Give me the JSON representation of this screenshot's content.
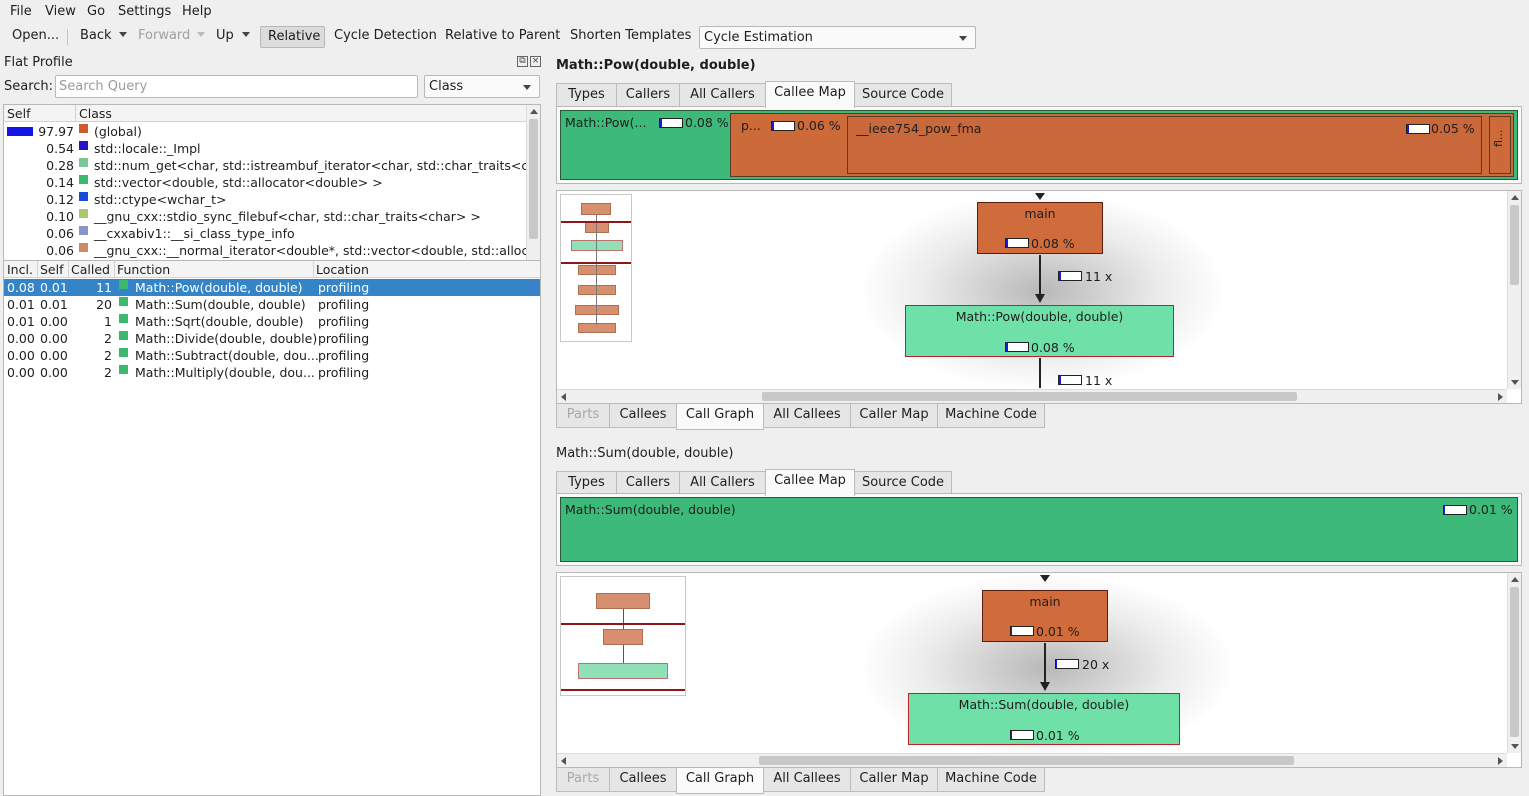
{
  "menu": [
    "File",
    "View",
    "Go",
    "Settings",
    "Help"
  ],
  "toolbar": {
    "open": "Open...",
    "back": "Back",
    "forward": "Forward",
    "up": "Up",
    "relative": "Relative",
    "cycle_detection": "Cycle Detection",
    "relative_to_parent": "Relative to Parent",
    "shorten_templates": "Shorten Templates",
    "cycle_estimation": "Cycle Estimation"
  },
  "flat_profile": {
    "title": "Flat Profile",
    "search_label": "Search:",
    "search_placeholder": "Search Query",
    "group_by": "Class",
    "class_headers": [
      "Self",
      "Class"
    ],
    "classes": [
      {
        "self": "97.97",
        "name": "(global)",
        "color": "#cc5a2a",
        "bar": 0.98
      },
      {
        "self": "0.54",
        "name": "std::locale::_Impl",
        "color": "#2a12c8"
      },
      {
        "self": "0.28",
        "name": "std::num_get<char, std::istreambuf_iterator<char, std::char_traits<c...",
        "color": "#7ac89a"
      },
      {
        "self": "0.14",
        "name": "std::vector<double, std::allocator<double> >",
        "color": "#3aba70"
      },
      {
        "self": "0.12",
        "name": "std::ctype<wchar_t>",
        "color": "#1a4ad8"
      },
      {
        "self": "0.10",
        "name": "__gnu_cxx::stdio_sync_filebuf<char, std::char_traits<char> >",
        "color": "#a8c86a"
      },
      {
        "self": "0.06",
        "name": "__cxxabiv1::__si_class_type_info",
        "color": "#8a94c8"
      },
      {
        "self": "0.06",
        "name": "__gnu_cxx::__normal_iterator<double*, std::vector<double, std::alloc...",
        "color": "#cc8a6a"
      }
    ],
    "func_headers": [
      "Incl.",
      "Self",
      "Called",
      "Function",
      "Location"
    ],
    "functions": [
      {
        "incl": "0.08",
        "self": "0.01",
        "called": "11",
        "name": "Math::Pow(double, double)",
        "location": "profiling"
      },
      {
        "incl": "0.01",
        "self": "0.01",
        "called": "20",
        "name": "Math::Sum(double, double)",
        "location": "profiling"
      },
      {
        "incl": "0.01",
        "self": "0.00",
        "called": "1",
        "name": "Math::Sqrt(double, double)",
        "location": "profiling"
      },
      {
        "incl": "0.00",
        "self": "0.00",
        "called": "2",
        "name": "Math::Divide(double, double)",
        "location": "profiling"
      },
      {
        "incl": "0.00",
        "self": "0.00",
        "called": "2",
        "name": "Math::Subtract(double, dou...",
        "location": "profiling"
      },
      {
        "incl": "0.00",
        "self": "0.00",
        "called": "2",
        "name": "Math::Multiply(double, dou...",
        "location": "profiling"
      }
    ]
  },
  "top_tabs": [
    "Types",
    "Callers",
    "All Callers",
    "Callee Map",
    "Source Code"
  ],
  "bottom_tabs": [
    "Parts",
    "Callees",
    "Call Graph",
    "All Callees",
    "Caller Map",
    "Machine Code"
  ],
  "view1": {
    "title": "Math::Pow(double, double)",
    "map": {
      "root_label": "Math::Pow(...",
      "root_pct": "0.08 %",
      "child1_label": "p...",
      "child1_pct": "0.06 %",
      "child2_label": "__ieee754_pow_fma",
      "child2_pct": "0.05 %",
      "child3_label": "fl..."
    },
    "graph": {
      "caller": "main",
      "caller_pct": "0.08 %",
      "calls": "11 x",
      "callee": "Math::Pow(double, double)",
      "callee_pct": "0.08 %",
      "calls_below": "11 x"
    }
  },
  "view2": {
    "title": "Math::Sum(double, double)",
    "map": {
      "root_label": "Math::Sum(double, double)",
      "root_pct": "0.01 %"
    },
    "graph": {
      "caller": "main",
      "caller_pct": "0.01 %",
      "calls": "20 x",
      "callee": "Math::Sum(double, double)",
      "callee_pct": "0.01 %"
    }
  },
  "colors": {
    "green": "#3dba7a",
    "orange": "#cc6a3a",
    "selection": "#3584c8"
  }
}
